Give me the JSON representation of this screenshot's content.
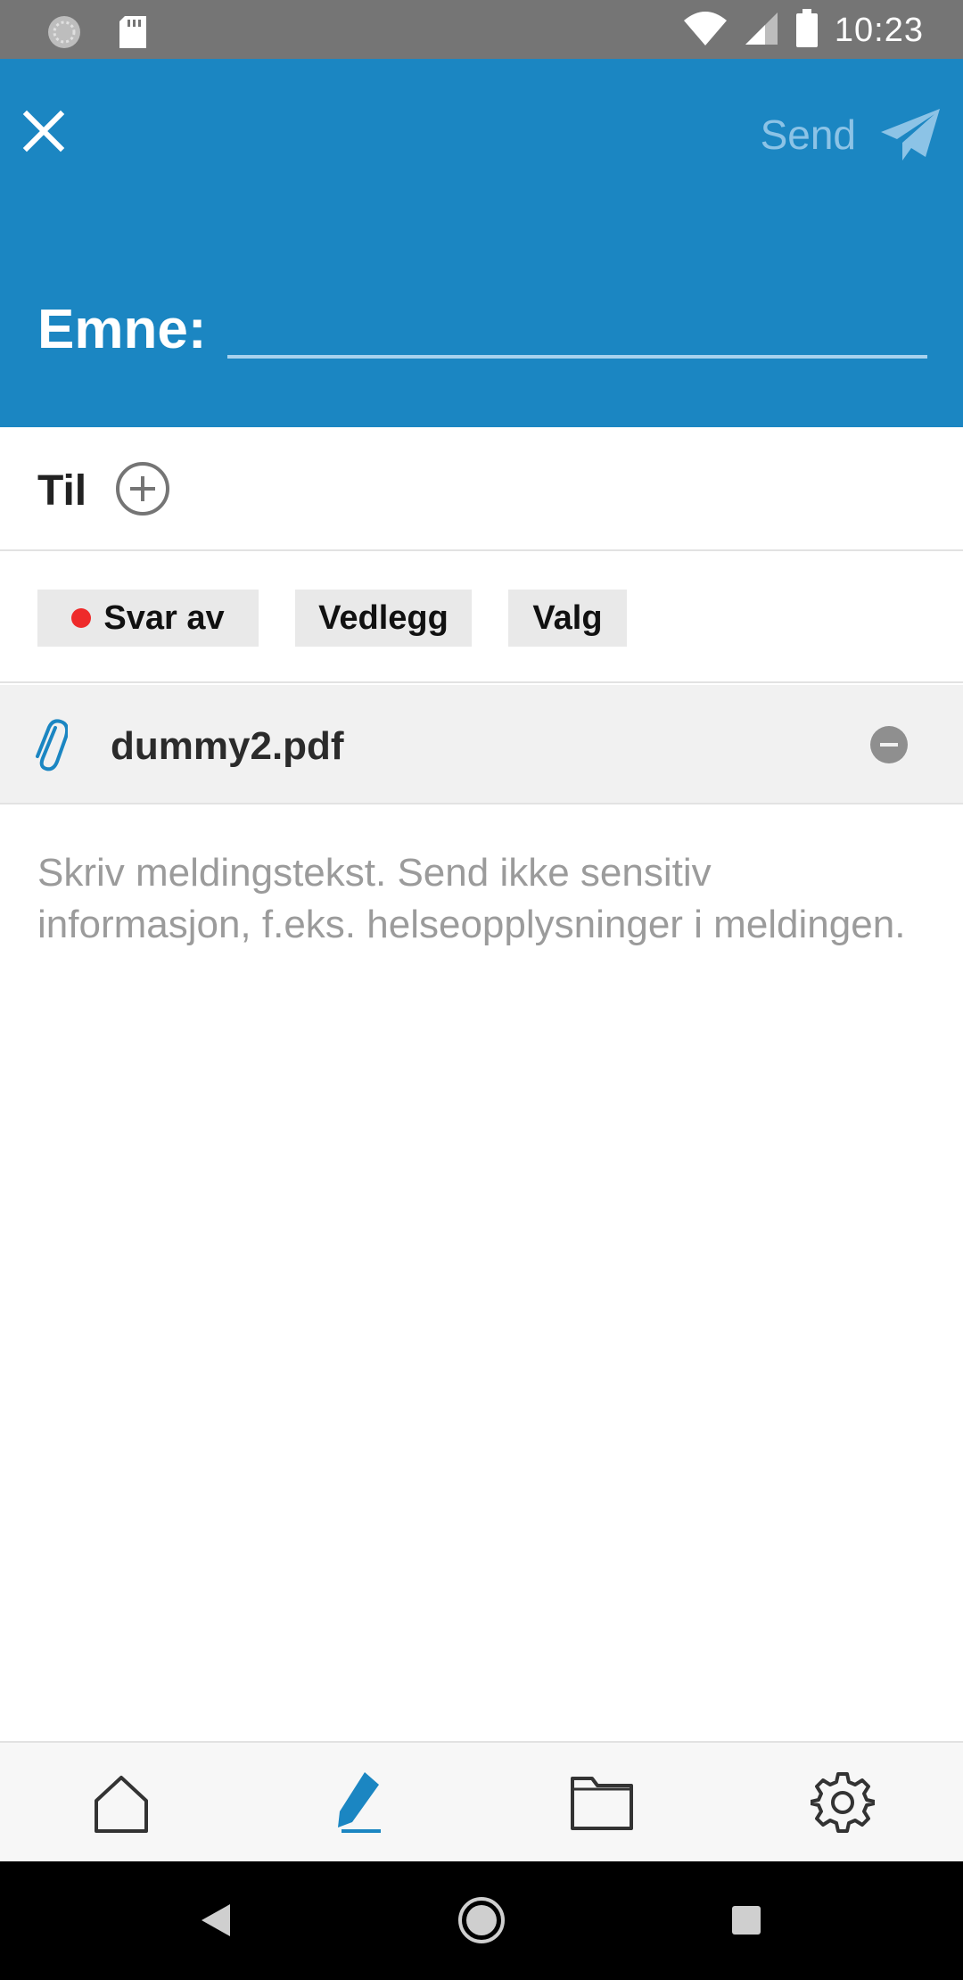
{
  "status_bar": {
    "time": "10:23",
    "icons": [
      "sync-icon",
      "sd-card-icon",
      "wifi-icon",
      "signal-icon",
      "battery-icon"
    ]
  },
  "header": {
    "close_icon": "close-icon",
    "send_label": "Send",
    "send_icon": "paper-plane-icon",
    "subject_label": "Emne:",
    "subject_value": ""
  },
  "recipients": {
    "label": "Til",
    "add_icon": "add-circle-icon"
  },
  "chips": {
    "reply": "Svar av",
    "attachments": "Vedlegg",
    "options": "Valg"
  },
  "attachment": {
    "icon": "paperclip-icon",
    "file_name": "dummy2.pdf",
    "remove_icon": "remove-circle-icon"
  },
  "body": {
    "placeholder": "Skriv meldingstekst. Send ikke sensitiv informasjon, f.eks. helseopplysninger i meldingen.",
    "value": ""
  },
  "bottom_nav": {
    "items": [
      "home-icon",
      "compose-icon",
      "folder-icon",
      "settings-icon"
    ],
    "active": "compose-icon"
  },
  "colors": {
    "header_bg": "#1b86c2",
    "send_disabled": "#8cc3e6",
    "accent": "#1b86c2",
    "reply_dot": "#ee2a2a"
  }
}
